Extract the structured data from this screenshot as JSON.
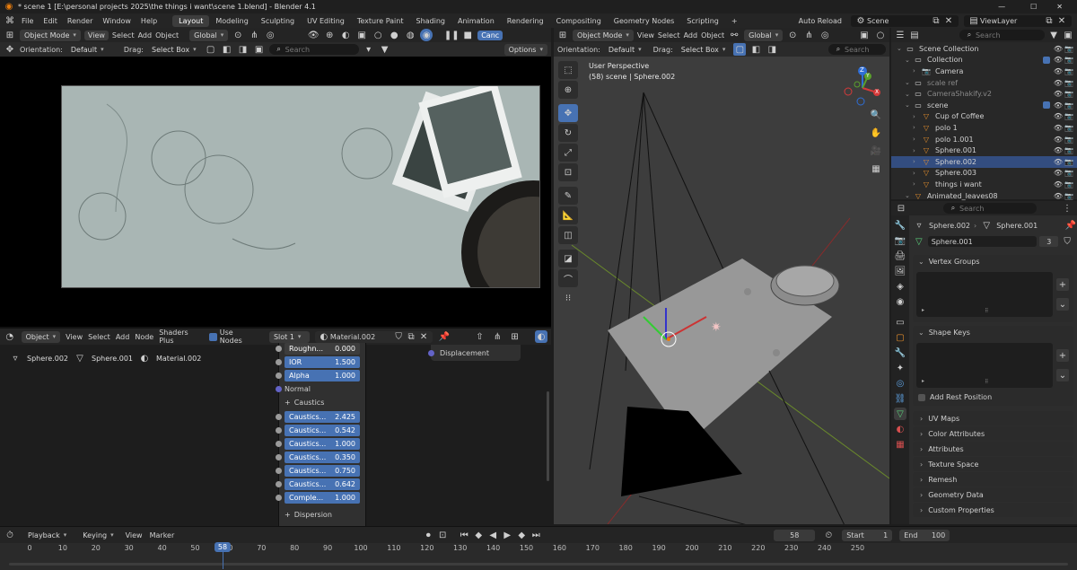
{
  "window": {
    "title": "* scene 1 [E:\\personal projects 2025\\the things i want\\scene 1.blend] - Blender 4.1",
    "controls": [
      "—",
      "☐",
      "✕"
    ]
  },
  "top_menu": [
    "File",
    "Edit",
    "Render",
    "Window",
    "Help"
  ],
  "workspaces": [
    "Layout",
    "Modeling",
    "Sculpting",
    "UV Editing",
    "Texture Paint",
    "Shading",
    "Animation",
    "Rendering",
    "Compositing",
    "Geometry Nodes",
    "Scripting"
  ],
  "workspace_add": "+",
  "top_right": {
    "auto_reload": "Auto Reload",
    "scene": "Scene",
    "view_layer": "ViewLayer"
  },
  "left_viewport": {
    "mode": "Object Mode",
    "menu": [
      "View",
      "Select",
      "Add",
      "Object"
    ],
    "transform": "Global",
    "orientation_label": "Orientation:",
    "orientation": "Default",
    "drag_label": "Drag:",
    "drag": "Select Box",
    "search_placeholder": "Search",
    "options": "Options",
    "cancel": "Canc"
  },
  "right_viewport": {
    "mode": "Object Mode",
    "menu": [
      "View",
      "Select",
      "Add",
      "Object"
    ],
    "transform": "Global",
    "orientation_label": "Orientation:",
    "orientation": "Default",
    "drag_label": "Drag:",
    "drag": "Select Box",
    "search_placeholder": "Search",
    "perspective": "User Perspective",
    "context": "(58) scene | Sphere.002",
    "gizmo": {
      "x": "X",
      "y": "Y",
      "z": "Z"
    }
  },
  "node_editor": {
    "type": "Object",
    "menu": [
      "View",
      "Select",
      "Add",
      "Node",
      "Shaders Plus"
    ],
    "use_nodes": "Use Nodes",
    "slot": "Slot 1",
    "material": "Material.002",
    "breadcrumb": [
      "Sphere.002",
      "Sphere.001",
      "Material.002"
    ],
    "fields": [
      {
        "label": "Roughn...",
        "value": "0.000",
        "blue": false
      },
      {
        "label": "IOR",
        "value": "1.500",
        "blue": true
      },
      {
        "label": "Alpha",
        "value": "1.000",
        "blue": true
      }
    ],
    "normal": "Normal",
    "caustics_header": "Caustics",
    "caustics": [
      {
        "label": "Caustics...",
        "value": "2.425"
      },
      {
        "label": "Caustics...",
        "value": "0.542"
      },
      {
        "label": "Caustics...",
        "value": "1.000"
      },
      {
        "label": "Caustics...",
        "value": "0.350"
      },
      {
        "label": "Caustics...",
        "value": "0.750"
      },
      {
        "label": "Caustics...",
        "value": "0.642"
      },
      {
        "label": "Comple...",
        "value": "1.000"
      }
    ],
    "dispersion_header": "Dispersion",
    "output_socket": "Displacement"
  },
  "outliner": {
    "search_placeholder": "Search",
    "items": [
      {
        "name": "Scene Collection",
        "indent": 0,
        "icon": "collection-icon",
        "sel": false,
        "check": false
      },
      {
        "name": "Collection",
        "indent": 1,
        "icon": "collection-icon",
        "sel": false,
        "check": true
      },
      {
        "name": "Camera",
        "indent": 2,
        "icon": "camera-icon",
        "sel": false,
        "check": false
      },
      {
        "name": "scale ref",
        "indent": 1,
        "icon": "collection-icon",
        "sel": false,
        "check": false,
        "dim": true
      },
      {
        "name": "CameraShakify.v2",
        "indent": 1,
        "icon": "collection-icon",
        "sel": false,
        "check": false,
        "dim": true
      },
      {
        "name": "scene",
        "indent": 1,
        "icon": "collection-icon",
        "sel": false,
        "check": true
      },
      {
        "name": "Cup of Coffee",
        "indent": 2,
        "icon": "mesh-icon",
        "sel": false,
        "check": false
      },
      {
        "name": "polo 1",
        "indent": 2,
        "icon": "mesh-icon",
        "sel": false,
        "check": false
      },
      {
        "name": "polo 1.001",
        "indent": 2,
        "icon": "mesh-icon",
        "sel": false,
        "check": false
      },
      {
        "name": "Sphere.001",
        "indent": 2,
        "icon": "mesh-icon",
        "sel": false,
        "check": false
      },
      {
        "name": "Sphere.002",
        "indent": 2,
        "icon": "mesh-icon",
        "sel": true,
        "check": false
      },
      {
        "name": "Sphere.003",
        "indent": 2,
        "icon": "mesh-icon",
        "sel": false,
        "check": false
      },
      {
        "name": "things i want",
        "indent": 2,
        "icon": "mesh-icon",
        "sel": false,
        "check": false
      },
      {
        "name": "Animated_leaves08",
        "indent": 1,
        "icon": "mesh-icon",
        "sel": false,
        "check": false
      }
    ]
  },
  "properties": {
    "search_placeholder": "Search",
    "object": "Sphere.002",
    "mesh": "Sphere.001",
    "datablock": "Sphere.001",
    "users": "3",
    "vertex_groups": "Vertex Groups",
    "shape_keys": "Shape Keys",
    "add_rest_position": "Add Rest Position",
    "panels": [
      "UV Maps",
      "Color Attributes",
      "Attributes",
      "Texture Space",
      "Remesh",
      "Geometry Data",
      "Custom Properties"
    ]
  },
  "timeline": {
    "menu": [
      "Playback",
      "Keying",
      "View",
      "Marker"
    ],
    "current_frame": "58",
    "start_label": "Start",
    "start": "1",
    "end_label": "End",
    "end": "100",
    "ticks": [
      "0",
      "10",
      "20",
      "30",
      "40",
      "50",
      "60",
      "70",
      "80",
      "90",
      "100",
      "110",
      "120",
      "130",
      "140",
      "150",
      "160",
      "170",
      "180",
      "190",
      "200",
      "210",
      "220",
      "230",
      "240",
      "250"
    ],
    "playhead": "58"
  }
}
